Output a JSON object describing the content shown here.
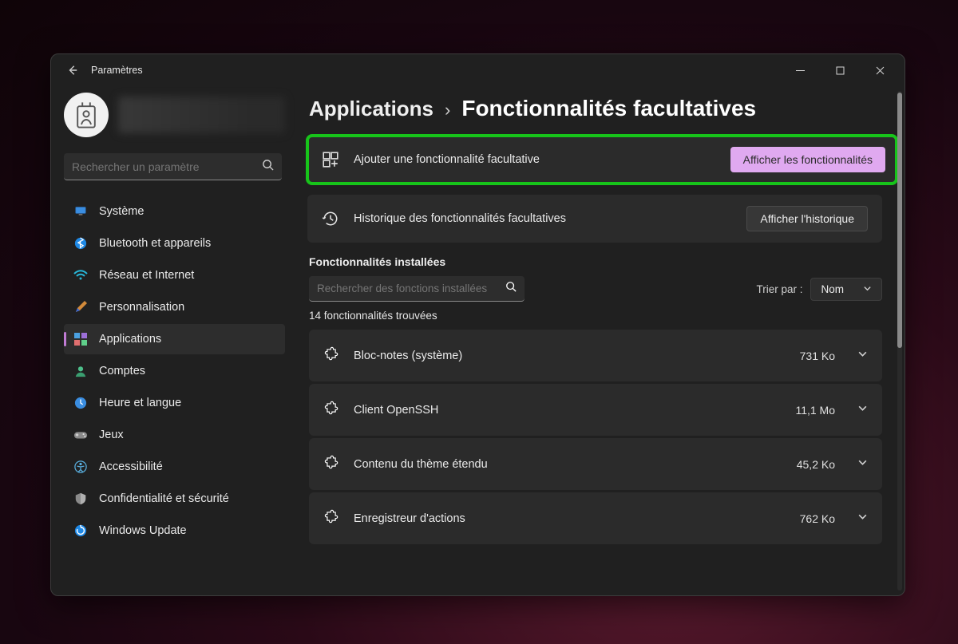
{
  "window": {
    "title": "Paramètres"
  },
  "search": {
    "placeholder": "Rechercher un paramètre"
  },
  "nav": {
    "items": [
      {
        "label": "Système"
      },
      {
        "label": "Bluetooth et appareils"
      },
      {
        "label": "Réseau et Internet"
      },
      {
        "label": "Personnalisation"
      },
      {
        "label": "Applications"
      },
      {
        "label": "Comptes"
      },
      {
        "label": "Heure et langue"
      },
      {
        "label": "Jeux"
      },
      {
        "label": "Accessibilité"
      },
      {
        "label": "Confidentialité et sécurité"
      },
      {
        "label": "Windows Update"
      }
    ]
  },
  "breadcrumb": {
    "parent": "Applications",
    "current": "Fonctionnalités facultatives"
  },
  "panels": {
    "add": {
      "label": "Ajouter une fonctionnalité facultative",
      "button": "Afficher les fonctionnalités"
    },
    "history": {
      "label": "Historique des fonctionnalités facultatives",
      "button": "Afficher l'historique"
    }
  },
  "installed": {
    "section_label": "Fonctionnalités installées",
    "search_placeholder": "Rechercher des fonctions installées",
    "sort_label": "Trier par :",
    "sort_value": "Nom",
    "count_text": "14 fonctionnalités trouvées",
    "items": [
      {
        "name": "Bloc-notes (système)",
        "size": "731 Ko"
      },
      {
        "name": "Client OpenSSH",
        "size": "11,1 Mo"
      },
      {
        "name": "Contenu du thème étendu",
        "size": "45,2 Ko"
      },
      {
        "name": "Enregistreur d'actions",
        "size": "762 Ko"
      }
    ]
  }
}
